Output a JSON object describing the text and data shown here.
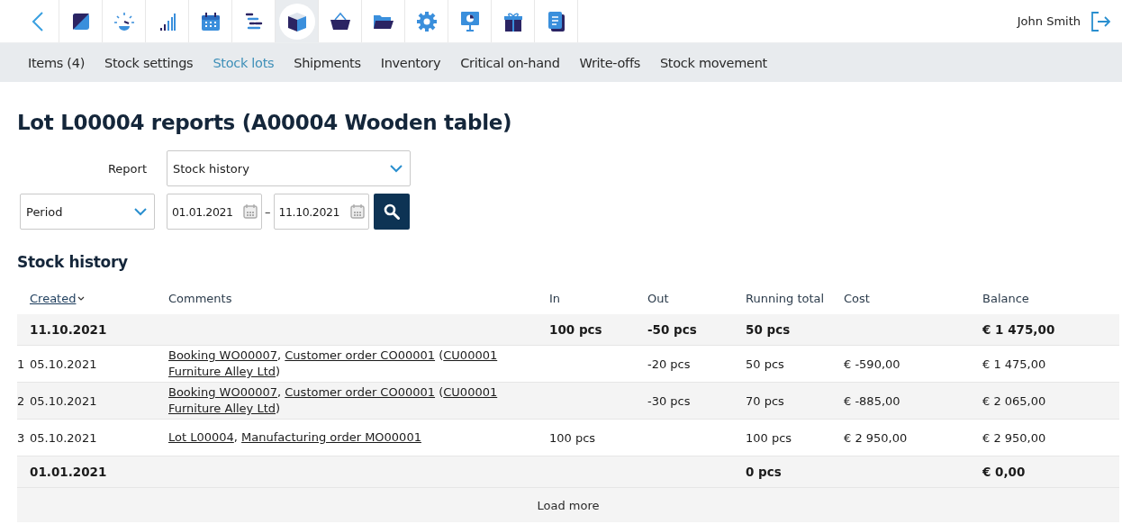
{
  "toolbar": {
    "back": {
      "kind": "back"
    },
    "apps": [
      {
        "kind": "square",
        "selected": false
      },
      {
        "kind": "gauge",
        "selected": false
      },
      {
        "kind": "signal",
        "selected": false
      },
      {
        "kind": "calendar",
        "selected": false
      },
      {
        "kind": "list",
        "selected": false
      },
      {
        "kind": "box",
        "selected": true
      },
      {
        "kind": "basket",
        "selected": false
      },
      {
        "kind": "folder",
        "selected": false
      },
      {
        "kind": "gear",
        "selected": false
      },
      {
        "kind": "presentation",
        "selected": false
      },
      {
        "kind": "gift",
        "selected": false
      },
      {
        "kind": "document",
        "selected": false
      }
    ],
    "user": "John Smith"
  },
  "tabs": [
    {
      "label": "Items (4)",
      "selected": false
    },
    {
      "label": "Stock settings",
      "selected": false
    },
    {
      "label": "Stock lots",
      "selected": true
    },
    {
      "label": "Shipments",
      "selected": false
    },
    {
      "label": "Inventory",
      "selected": false
    },
    {
      "label": "Critical on-hand",
      "selected": false
    },
    {
      "label": "Write-offs",
      "selected": false
    },
    {
      "label": "Stock movement",
      "selected": false
    }
  ],
  "title": "Lot L00004 reports (A00004 Wooden table)",
  "filters": {
    "report_label": "Report",
    "report": "Stock history",
    "period": "Period",
    "date_from": "01.01.2021",
    "date_separator": "–",
    "date_to": "11.10.2021"
  },
  "section_title": "Stock history",
  "table": {
    "columns": [
      {
        "label": "Created",
        "sortable": true
      },
      {
        "label": "Comments",
        "sortable": false
      },
      {
        "label": "In",
        "sortable": false
      },
      {
        "label": "Out",
        "sortable": false
      },
      {
        "label": "Running total",
        "sortable": false
      },
      {
        "label": "Cost",
        "sortable": false
      },
      {
        "label": "Balance",
        "sortable": false
      }
    ],
    "rows": [
      {
        "kind": "summary",
        "created": "11.10.2021",
        "in": "100 pcs",
        "out": "-50 pcs",
        "running_total": "50 pcs",
        "balance": "€ 1 475,00"
      },
      {
        "kind": "entry",
        "number": "1",
        "created": "05.10.2021",
        "comments": [
          {
            "kind": "link",
            "text": "Booking WO00007"
          },
          {
            "kind": "plain",
            "text": ", "
          },
          {
            "kind": "link",
            "text": "Customer order CO00001"
          },
          {
            "kind": "plain",
            "text": " ("
          },
          {
            "kind": "link",
            "text": "CU00001 Furniture Alley Ltd"
          },
          {
            "kind": "plain",
            "text": ")"
          }
        ],
        "out": "-20 pcs",
        "running_total": "50 pcs",
        "cost": "€ -590,00",
        "balance": "€ 1 475,00"
      },
      {
        "kind": "entry",
        "number": "2",
        "created": "05.10.2021",
        "comments": [
          {
            "kind": "link",
            "text": "Booking WO00007"
          },
          {
            "kind": "plain",
            "text": ", "
          },
          {
            "kind": "link",
            "text": "Customer order CO00001"
          },
          {
            "kind": "plain",
            "text": " ("
          },
          {
            "kind": "link",
            "text": "CU00001 Furniture Alley Ltd"
          },
          {
            "kind": "plain",
            "text": ")"
          }
        ],
        "out": "-30 pcs",
        "running_total": "70 pcs",
        "cost": "€ -885,00",
        "balance": "€ 2 065,00"
      },
      {
        "kind": "entry",
        "number": "3",
        "created": "05.10.2021",
        "comments": [
          {
            "kind": "link",
            "text": "Lot L00004"
          },
          {
            "kind": "plain",
            "text": ", "
          },
          {
            "kind": "link",
            "text": "Manufacturing order MO00001"
          }
        ],
        "in": "100 pcs",
        "running_total": "100 pcs",
        "cost": "€ 2 950,00",
        "balance": "€ 2 950,00"
      },
      {
        "kind": "summary",
        "created": "01.01.2021",
        "running_total": "0 pcs",
        "balance": "€ 0,00"
      }
    ],
    "load_more": "Load more"
  }
}
